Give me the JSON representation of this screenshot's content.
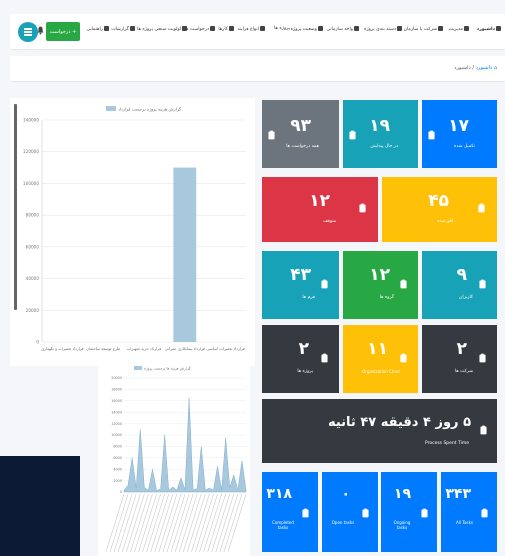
{
  "nav": {
    "items": [
      "داشبورد",
      "مدیریت",
      "شرکت یا سازمان",
      "دسته بندی پروژه",
      "واحد سازمانی",
      "وضعیت پروژه",
      "پروژه ها",
      "انواع فرایند",
      "کارها",
      "درخواست ها",
      "اولویت سنجی پروژه ها",
      "گزارشات",
      "راهنمایی"
    ],
    "request_button": "+ درخواست"
  },
  "breadcrumb": {
    "home": "داشبورد",
    "current": "داشبورد"
  },
  "tiles": {
    "finished": {
      "value": "۱۷",
      "label": "تکمیل شده"
    },
    "in_progress": {
      "value": "۱۹",
      "label": "در حال پیدایش"
    },
    "total_requests": {
      "value": "۹۳",
      "label": "همه درخواست ها"
    },
    "rejected": {
      "value": "۴۵",
      "label": "لغو شده"
    },
    "stopped": {
      "value": "۱۲",
      "label": "متوقف"
    },
    "users": {
      "value": "۹",
      "label": "کاربران"
    },
    "groups": {
      "value": "۱۲",
      "label": "گروه ها"
    },
    "units": {
      "value": "۴۳",
      "label": "فرم ها"
    },
    "companies": {
      "value": "۲",
      "label": "شرکت ها"
    },
    "org_chart": {
      "value": "۱۱",
      "label": "Organization Chart"
    },
    "projects": {
      "value": "۲",
      "label": "پروژه ها"
    },
    "process_time": {
      "value": "۵ روز ۴ دقیقه ۴۷ ثانیه",
      "label": "Process Spent Time"
    },
    "all_tasks": {
      "value": "۳۴۳",
      "label": "All Tasks"
    },
    "ongoing": {
      "value": "۱۹",
      "label": "Ongoing tasks"
    },
    "open": {
      "value": "۰",
      "label": "Open tasks"
    },
    "completed": {
      "value": "۳۱۸",
      "label": "Completed tasks"
    }
  },
  "colors": {
    "blue": "#007bff",
    "teal": "#17a2b8",
    "gray": "#6c757d",
    "red": "#dc3545",
    "yellow": "#ffc107",
    "green": "#28a745",
    "dark": "#343a40",
    "bar": "#a8c8de"
  },
  "chart_data": [
    {
      "type": "bar",
      "title": "",
      "legend": "گزارش هزینه پروژه برحسب قرارداد",
      "categories": [
        "قرارداد تعمیرات و نگهداری",
        "طرح توسعه ساختمان",
        "قرارداد خرید تجهیزات",
        "قرارداد پیمانکاری عمرانی",
        "قرارداد تعمیرات اساسی"
      ],
      "values": [
        0,
        0,
        0,
        110000,
        0
      ],
      "ylim": [
        0,
        140000
      ],
      "yticks": [
        0,
        20000,
        40000,
        60000,
        80000,
        100000,
        120000,
        140000
      ]
    },
    {
      "type": "area",
      "legend": "گزارش هزینه ها برحسب پروژه",
      "values": [
        300,
        1200,
        6000,
        700,
        11000,
        800,
        300,
        4000,
        300,
        500,
        10000,
        300,
        900,
        300,
        2500,
        400,
        16500,
        300,
        600,
        8000,
        300,
        700,
        300,
        4500,
        300,
        9500,
        800,
        3000,
        300,
        5500,
        300
      ],
      "ylim": [
        0,
        20000
      ],
      "yticks": [
        0,
        2000,
        4000,
        6000,
        8000,
        10000,
        12000,
        14000,
        16000,
        18000,
        20000
      ]
    }
  ]
}
